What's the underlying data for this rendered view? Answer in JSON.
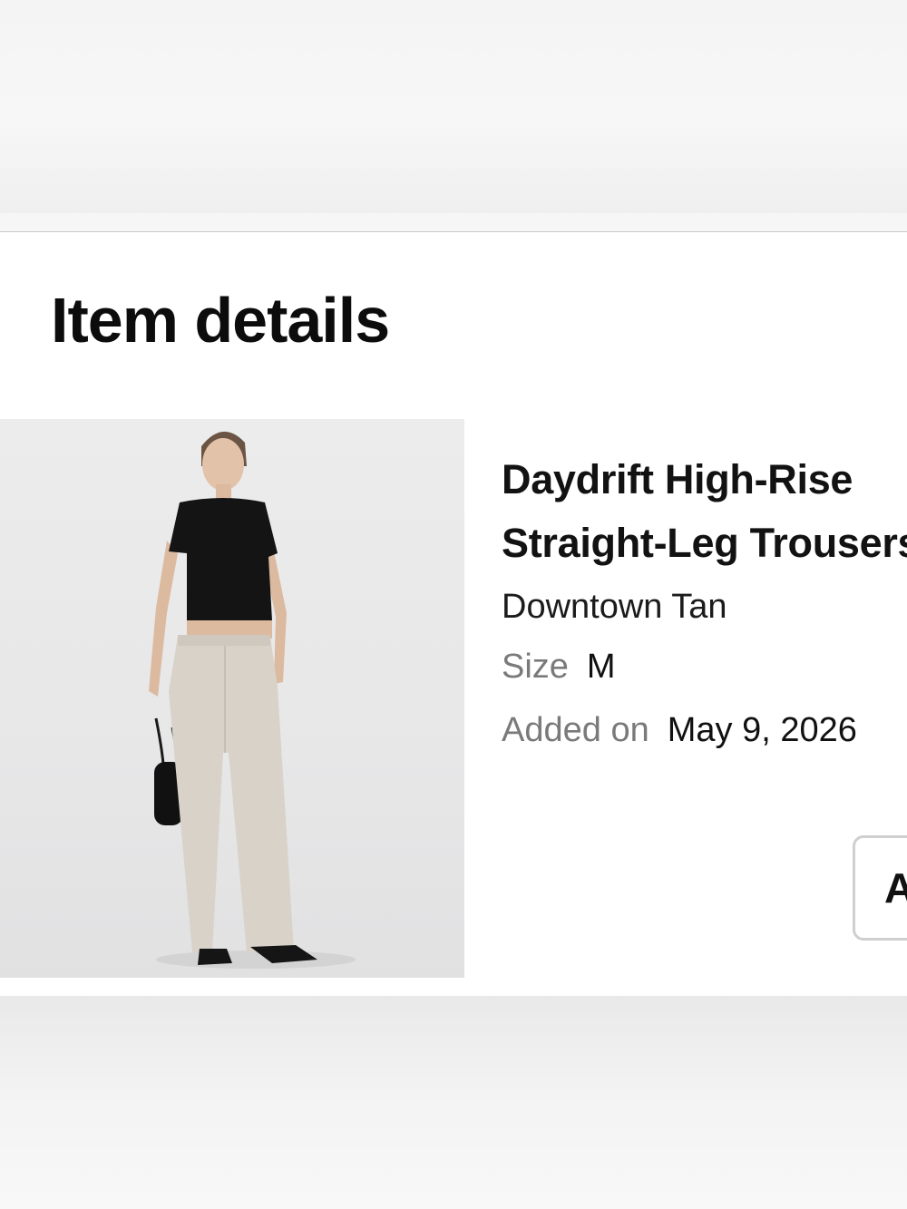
{
  "section": {
    "title": "Item details"
  },
  "item": {
    "name_line1": "Daydrift High-Rise",
    "name_line2": "Straight-Leg Trousers",
    "color": "Downtown Tan",
    "size_label": "Size",
    "size_value": "M",
    "added_label": "Added on",
    "added_value": "May 9, 2026",
    "image_icon": "product-photo"
  },
  "action_button": {
    "label": "A"
  },
  "colors": {
    "text": "#111111",
    "label_grey": "#7a7a7a",
    "button_border": "#cfcfcf"
  }
}
